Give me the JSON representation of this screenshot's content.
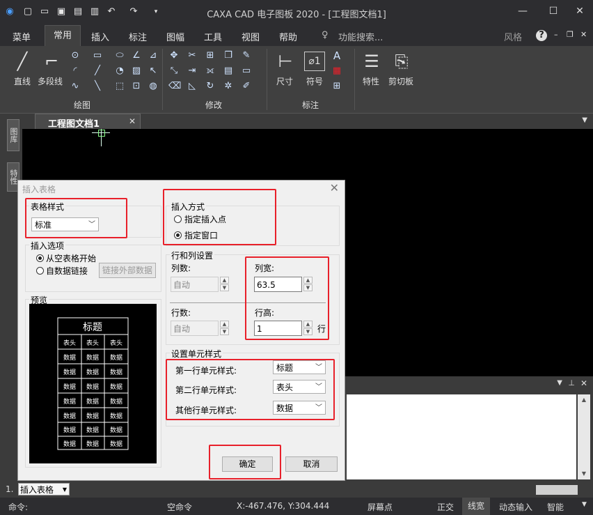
{
  "app": {
    "title": "CAXA CAD 电子图板 2020 - [工程图文档1]",
    "min": "—",
    "max": "☐",
    "close": "✕"
  },
  "menubar": {
    "items": [
      "菜单",
      "常用",
      "插入",
      "标注",
      "图幅",
      "工具",
      "视图",
      "帮助"
    ],
    "search": "功能搜索...",
    "style": "风格"
  },
  "ribbon": {
    "line_label": "直线",
    "polyline_label": "多段线",
    "draw_group": "绘图",
    "modify_group": "修改",
    "dim_label": "尺寸",
    "symbol_label": "符号",
    "annotate_group": "标注",
    "props_label": "特性",
    "clipboard_label": "剪切板"
  },
  "doc_tab": "工程图文档1",
  "sidebar": {
    "tab1": "图库",
    "tab2": "特性"
  },
  "dialog": {
    "title": "插入表格",
    "table_style_group": "表格样式",
    "table_style_value": "标准",
    "insert_options_group": "插入选项",
    "opt_empty": "从空表格开始",
    "opt_link": "自数据链接",
    "link_button": "链接外部数据",
    "preview_group": "预览",
    "preview_title": "标题",
    "preview_header": "表头",
    "preview_data": "数据",
    "insert_mode_group": "插入方式",
    "mode_point": "指定插入点",
    "mode_window": "指定窗口",
    "rowcol_group": "行和列设置",
    "cols_label": "列数:",
    "cols_value": "自动",
    "colwidth_label": "列宽:",
    "colwidth_value": "63.5",
    "rows_label": "行数:",
    "rows_value": "自动",
    "rowheight_label": "行高:",
    "rowheight_value": "1",
    "row_unit": "行",
    "cellstyle_group": "设置单元样式",
    "row1_label": "第一行单元样式:",
    "row1_value": "标题",
    "row2_label": "第二行单元样式:",
    "row2_value": "表头",
    "other_label": "其他行单元样式:",
    "other_value": "数据",
    "ok": "确定",
    "cancel": "取消"
  },
  "cmdtab": {
    "index": "1.",
    "label": "插入表格"
  },
  "status": {
    "cmd_label": "命令:",
    "empty_cmd": "空命令",
    "coords": "X:-467.476, Y:304.444",
    "snap": "屏幕点",
    "ortho": "正交",
    "lineweight": "线宽",
    "dyn_input": "动态输入",
    "smart": "智能"
  },
  "colors": {
    "highlight": "#e8202a",
    "canvas": "#000000"
  }
}
